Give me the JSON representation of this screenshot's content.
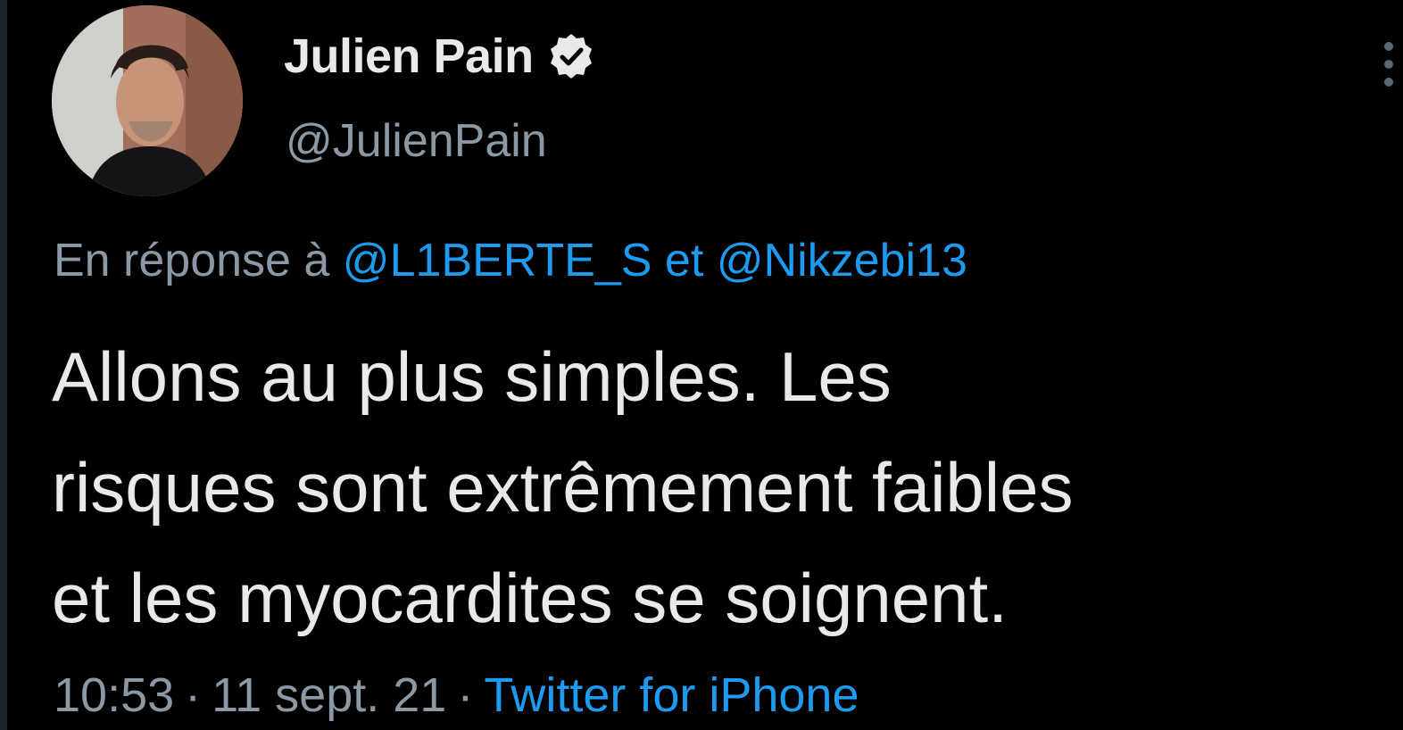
{
  "tweet": {
    "display_name": "Julien Pain",
    "handle": "@JulienPain",
    "verified": true,
    "reply": {
      "prefix": "En réponse à",
      "mention_1": "@L1BERTE_S",
      "joiner": "et",
      "mention_2": "@Nikzebi13"
    },
    "text_lines": [
      "Allons au plus simples. Les",
      "risques sont extrêmement faibles",
      "et les myocardites se soignent."
    ],
    "meta": {
      "time": "10:53",
      "separator": "·",
      "date": "11 sept. 21",
      "source": "Twitter for iPhone"
    }
  },
  "icons": {
    "verified": "verified-badge-icon",
    "more": "more-options-icon"
  },
  "colors": {
    "background": "#000000",
    "primary_text": "#e7e9ea",
    "secondary_text": "#8b98a5",
    "accent": "#1d9bf0"
  }
}
